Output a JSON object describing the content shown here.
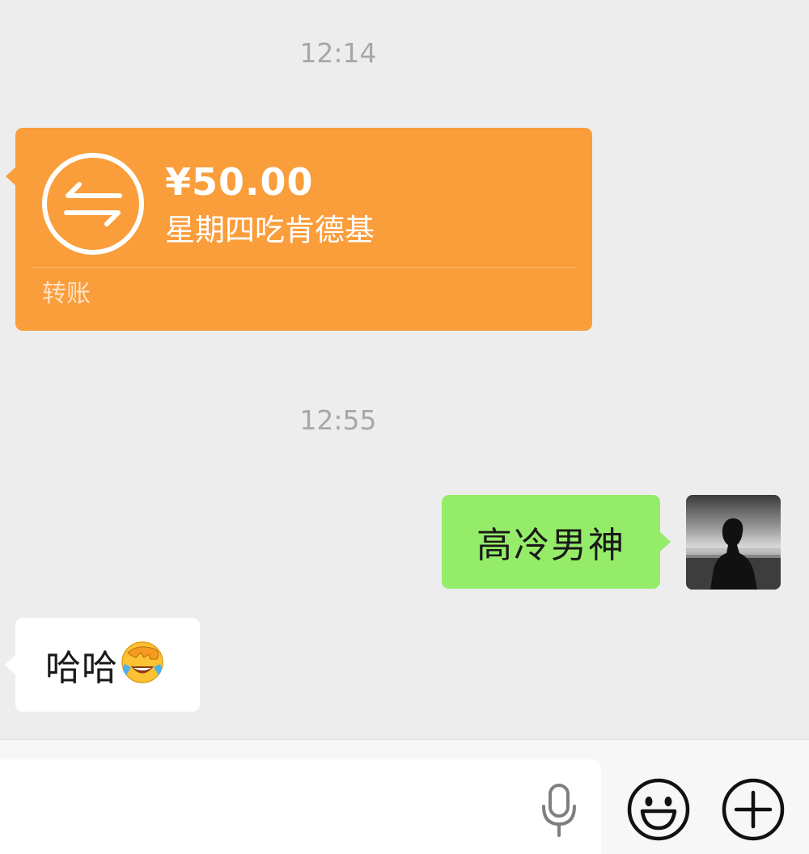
{
  "chat": {
    "timestamps": [
      "12:14",
      "12:55"
    ],
    "transfer": {
      "amount": "¥50.00",
      "note": "星期四吃肯德基",
      "label": "转账",
      "icon": "transfer-arrows-icon",
      "color": "#fa9d3b"
    },
    "sent_message": {
      "text": "高冷男神",
      "color": "#95ec69"
    },
    "received_message": {
      "text": "哈哈",
      "emoji": "face-palm-laughing-emoji"
    },
    "avatar": {
      "description_icon": "avatar-silhouette-image"
    }
  },
  "input_bar": {
    "placeholder": "",
    "voice_icon": "microphone-icon",
    "emoji_icon": "smiley-face-icon",
    "more_icon": "plus-circle-icon"
  }
}
